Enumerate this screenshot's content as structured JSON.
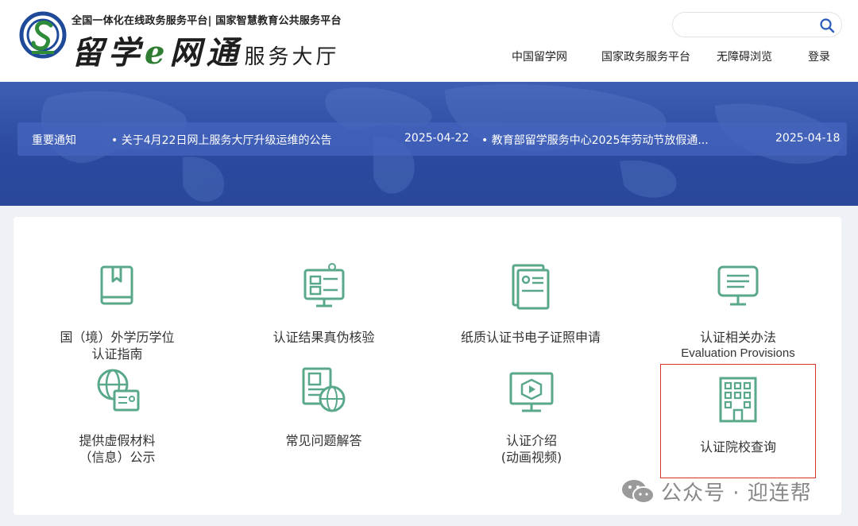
{
  "header": {
    "tagline": "全国一体化在线政务服务平台| 国家智慧教育公共服务平台",
    "brand_prefix": "留学",
    "brand_e": "e",
    "brand_main": "网通",
    "brand_suffix": "服务大厅",
    "search_placeholder": "",
    "nav": [
      "中国留学网",
      "国家政务服务平台",
      "无障碍浏览",
      "登录"
    ]
  },
  "notice": {
    "label": "重要通知",
    "items": [
      {
        "title": "关于4月22日网上服务大厅升级运维的公告",
        "date": "2025-04-22"
      },
      {
        "title": "教育部留学服务中心2025年劳动节放假通...",
        "date": "2025-04-18"
      }
    ]
  },
  "services": [
    {
      "label": "国（境）外学历学位",
      "label2": "认证指南",
      "icon": "book-icon"
    },
    {
      "label": "认证结果真伪核验",
      "icon": "monitor-verify-icon"
    },
    {
      "label": "纸质认证书电子证照申请",
      "icon": "document-card-icon"
    },
    {
      "label": "认证相关办法",
      "label2": "Evaluation Provisions",
      "icon": "notice-board-icon"
    },
    {
      "label": "提供虚假材料",
      "label2": "（信息）公示",
      "icon": "globe-id-icon"
    },
    {
      "label": "常见问题解答",
      "icon": "profile-globe-icon"
    },
    {
      "label": "认证介绍",
      "label2": "(动画视频)",
      "icon": "video-screen-icon"
    },
    {
      "label": "认证院校查询",
      "icon": "building-icon"
    }
  ],
  "watermark": {
    "text": "公众号 · 迎连帮",
    "icon": "wechat-icon"
  },
  "colors": {
    "accent": "#5aa88a",
    "banner": "#2b4aa0",
    "highlight": "#d9302b"
  }
}
